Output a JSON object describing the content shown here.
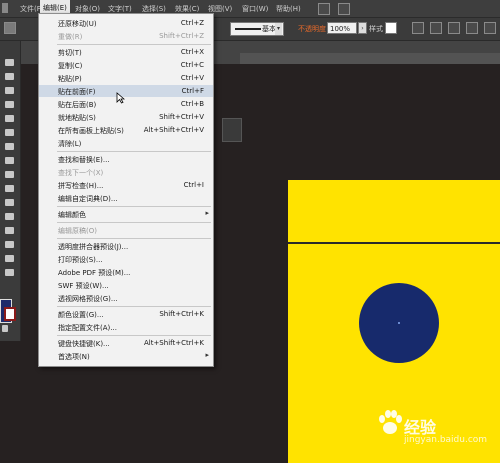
{
  "menubar": {
    "items": [
      "文件(F)",
      "编辑(E)",
      "对象(O)",
      "文字(T)",
      "选择(S)",
      "效果(C)",
      "视图(V)",
      "窗口(W)",
      "帮助(H)"
    ]
  },
  "toolbar": {
    "stroke_label": "基本",
    "opacity_label": "不透明度",
    "opacity_value": "100%",
    "style_label": "样式"
  },
  "edit_menu": {
    "rows": [
      {
        "label": "还原移动(U)",
        "shortcut": "Ctrl+Z",
        "disabled": false
      },
      {
        "label": "重做(R)",
        "shortcut": "Shift+Ctrl+Z",
        "disabled": true
      },
      {
        "label": "剪切(T)",
        "shortcut": "Ctrl+X",
        "disabled": false
      },
      {
        "label": "复制(C)",
        "shortcut": "Ctrl+C",
        "disabled": false
      },
      {
        "label": "粘贴(P)",
        "shortcut": "Ctrl+V",
        "disabled": false
      },
      {
        "label": "贴在前面(F)",
        "shortcut": "Ctrl+F",
        "disabled": false
      },
      {
        "label": "贴在后面(B)",
        "shortcut": "Ctrl+B",
        "disabled": false
      },
      {
        "label": "就地粘贴(S)",
        "shortcut": "Shift+Ctrl+V",
        "disabled": false
      },
      {
        "label": "在所有画板上粘贴(S)",
        "shortcut": "Alt+Shift+Ctrl+V",
        "disabled": false
      },
      {
        "label": "清除(L)",
        "shortcut": "",
        "disabled": false
      },
      {
        "label": "查找和替换(E)...",
        "shortcut": "",
        "disabled": false
      },
      {
        "label": "查找下一个(X)",
        "shortcut": "",
        "disabled": true
      },
      {
        "label": "拼写检查(H)...",
        "shortcut": "Ctrl+I",
        "disabled": false
      },
      {
        "label": "编辑自定词典(D)...",
        "shortcut": "",
        "disabled": false
      },
      {
        "label": "编辑颜色",
        "shortcut": "",
        "disabled": false
      },
      {
        "label": "编辑原稿(O)",
        "shortcut": "",
        "disabled": true
      },
      {
        "label": "透明度拼合器预设(J)...",
        "shortcut": "",
        "disabled": false
      },
      {
        "label": "打印预设(S)...",
        "shortcut": "",
        "disabled": false
      },
      {
        "label": "Adobe PDF 预设(M)...",
        "shortcut": "",
        "disabled": false
      },
      {
        "label": "SWF 预设(W)...",
        "shortcut": "",
        "disabled": false
      },
      {
        "label": "透视网格预设(G)...",
        "shortcut": "",
        "disabled": false
      },
      {
        "label": "颜色设置(G)...",
        "shortcut": "Shift+Ctrl+K",
        "disabled": false
      },
      {
        "label": "指定配置文件(A)...",
        "shortcut": "",
        "disabled": false
      },
      {
        "label": "键盘快捷键(K)...",
        "shortcut": "Alt+Shift+Ctrl+K",
        "disabled": false
      },
      {
        "label": "首选项(N)",
        "shortcut": "",
        "disabled": false
      }
    ]
  },
  "watermark": {
    "brand": "经验",
    "url": "jingyan.baidu.com"
  },
  "colors": {
    "artboard": "#ffe300",
    "circle": "#172a6c",
    "canvas_bg": "#262121",
    "menu_bg": "#f2f2f2",
    "menu_hover": "#cfd9e6"
  }
}
